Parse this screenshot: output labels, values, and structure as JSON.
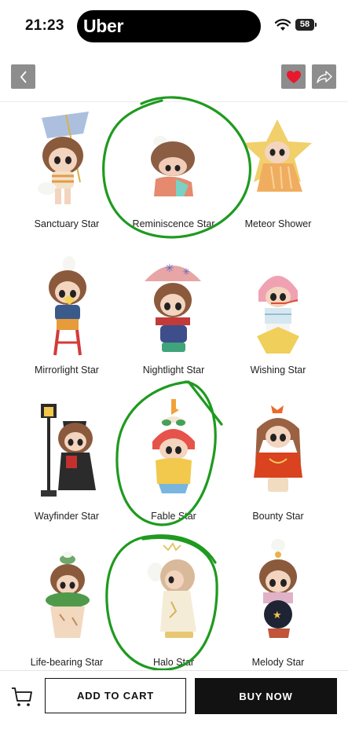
{
  "status_bar": {
    "time": "21:23",
    "app_pill_text": "Uber",
    "battery": "58"
  },
  "toolbar": {
    "back_icon": "chevron-left-icon",
    "favorite_icon": "heart-icon",
    "share_icon": "share-arrow-icon",
    "favorite_color": "#e8192c"
  },
  "products": [
    {
      "name": "Sanctuary Star",
      "circled": false
    },
    {
      "name": "Reminiscence Star",
      "circled": true
    },
    {
      "name": "Meteor Shower",
      "circled": false
    },
    {
      "name": "Mirrorlight Star",
      "circled": false
    },
    {
      "name": "Nightlight Star",
      "circled": false
    },
    {
      "name": "Wishing Star",
      "circled": false
    },
    {
      "name": "Wayfinder Star",
      "circled": false
    },
    {
      "name": "Fable Star",
      "circled": true
    },
    {
      "name": "Bounty Star",
      "circled": false
    },
    {
      "name": "Life-bearing Star",
      "circled": false
    },
    {
      "name": "Halo Star",
      "circled": true
    },
    {
      "name": "Melody Star",
      "circled": false
    }
  ],
  "bottom_bar": {
    "cart_icon": "cart-icon",
    "add_to_cart": "ADD TO CART",
    "buy_now": "BUY NOW"
  },
  "annotation_color": "#1f9a1f"
}
